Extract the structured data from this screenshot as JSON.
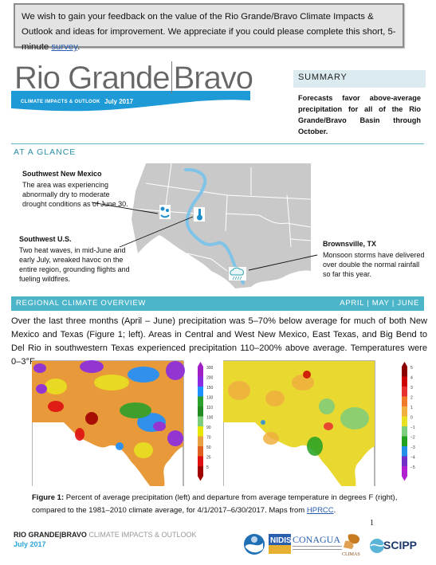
{
  "survey": {
    "text": "We wish to gain your feedback on the value of the Rio Grande/Bravo Climate Impacts & Outlook and ideas for improvement. We appreciate if you could please complete this short, 5-minute ",
    "link_label": "survey",
    "trailing": "."
  },
  "masthead": {
    "title_left": "Rio Grande",
    "title_right": "Bravo",
    "subtitle": "CLIMATE IMPACTS & OUTLOOK",
    "date": "July 2017",
    "accent_color": "#1e9ad6"
  },
  "summary": {
    "heading": "SUMMARY",
    "text": "Forecasts favor above-average precipitation for all of the Rio Grande/Bravo Basin through October."
  },
  "at_a_glance": {
    "heading": "AT A GLANCE",
    "callouts": [
      {
        "title": "Southwest New Mexico",
        "text": "The area was experiencing abnormally dry to moderate drought conditions as of June 30.",
        "icon": "drought-icon"
      },
      {
        "title": "Southwest U.S.",
        "text": "Two heat waves, in mid-June and early July, wreaked havoc on the entire region, grounding flights and fueling wildfires.",
        "icon": "thermometer-icon"
      },
      {
        "title": "Brownsville, TX",
        "text": "Monsoon storms have delivered over double the normal rainfall so far this year.",
        "icon": "rain-cloud-icon"
      }
    ]
  },
  "overview": {
    "heading": "REGIONAL CLIMATE OVERVIEW",
    "months": "APRIL | MAY | JUNE",
    "text": "Over the last three months (April – June) precipitation was 5–70% below average for much of both New Mexico and Texas (Figure 1; left). Areas in Central and West New Mexico, East Texas, and Big Bend to Del Rio in southwestern Texas experienced precipitation 110–200% above average. Temperatures were 0–3°F"
  },
  "figure": {
    "precip_legend": [
      "300",
      "200",
      "150",
      "130",
      "110",
      "100",
      "90",
      "70",
      "50",
      "25",
      "5"
    ],
    "precip_colors": [
      "#a020c8",
      "#8a2be2",
      "#1e90ff",
      "#2ca02c",
      "#228b22",
      "#7ccd7c",
      "#e6e600",
      "#e8a040",
      "#e06020",
      "#e01010",
      "#a00000"
    ],
    "temp_legend": [
      "5",
      "4",
      "3",
      "2",
      "1",
      "0",
      "−1",
      "−2",
      "−3",
      "−4",
      "−5"
    ],
    "temp_colors": [
      "#8b0000",
      "#cc0000",
      "#e83030",
      "#ef7a2a",
      "#f0b040",
      "#e8e020",
      "#7ccd7c",
      "#22a022",
      "#2090e8",
      "#7030c8",
      "#b020d0"
    ],
    "caption_label": "Figure 1:",
    "caption_text": " Percent of average precipitation (left) and departure from average temperature in degrees F (right), compared to the 1981–2010 climate average, for 4/1/2017–6/30/2017. Maps from ",
    "caption_link": "HPRCC",
    "caption_end": "."
  },
  "page_number": "1",
  "footer": {
    "title_bold": "RIO GRANDE|BRAVO",
    "title_light": " CLIMATE IMPACTS & OUTLOOK",
    "date": "July 2017",
    "logos": [
      "NOAA",
      "NIDIS",
      "CONAGUA",
      "CLIMAS",
      "SCIPP"
    ]
  }
}
